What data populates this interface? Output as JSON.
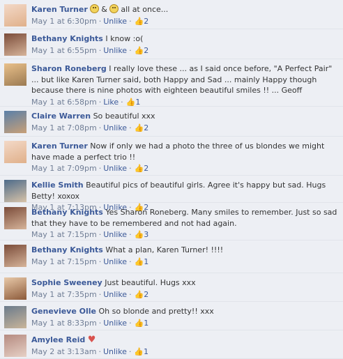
{
  "comments": [
    {
      "name": "Karen Turner",
      "text": "",
      "time": "May 1 at 6:30pm",
      "action": "Unlike",
      "likes": "2",
      "avatar": "karen-turner-avatar",
      "colors": [
        "#f3d9c8",
        "#e0b08a"
      ],
      "rich": {
        "mid": "&",
        "tail": "all at once..."
      }
    },
    {
      "name": "Bethany Knights",
      "text": "I know :o(",
      "time": "May 1 at 6:55pm",
      "action": "Unlike",
      "likes": "2",
      "avatar": "bethany-knights-avatar",
      "colors": [
        "#7b4c3a",
        "#d6b49a"
      ]
    },
    {
      "name": "Sharon Roneberg",
      "text": "I really love these ... as I said once before, \"A Perfect Pair\" ... but like Karen Turner said, both Happy and Sad ... mainly Happy though because there is nine photos with eighteen beautiful smiles !! ... Geoff",
      "time": "May 1 at 6:58pm",
      "action": "Like",
      "likes": "1",
      "avatar": "sharon-roneberg-avatar",
      "colors": [
        "#e9c08a",
        "#9b7a52"
      ]
    },
    {
      "name": "Claire Warren",
      "text": "So beautiful xxx",
      "time": "May 1 at 7:08pm",
      "action": "Unlike",
      "likes": "2",
      "avatar": "claire-warren-avatar",
      "colors": [
        "#5a7fa8",
        "#c8a078"
      ]
    },
    {
      "name": "Karen Turner",
      "text": "Now if only we had a photo the three of us blondes we might have made a perfect trio !!",
      "time": "May 1 at 7:09pm",
      "action": "Unlike",
      "likes": "2",
      "avatar": "karen-turner-avatar",
      "colors": [
        "#f3d9c8",
        "#e0b08a"
      ]
    },
    {
      "name": "Kellie Smith",
      "text": "Beautiful pics of beautiful girls. Agree it's happy but sad. Hugs Betty! xoxox",
      "time": "May 1 at 7:13pm",
      "action": "Unlike",
      "likes": "2",
      "avatar": "kellie-smith-avatar",
      "colors": [
        "#4d6b8a",
        "#d8c3a8"
      ]
    },
    {
      "name": "Bethany Knights",
      "text": "Yes Sharon Roneberg. Many smiles to remember. Just so sad that they have to be remembered and not had again.",
      "time": "May 1 at 7:15pm",
      "action": "Unlike",
      "likes": "3",
      "avatar": "bethany-knights-avatar",
      "colors": [
        "#7b4c3a",
        "#d6b49a"
      ]
    },
    {
      "name": "Bethany Knights",
      "text": "What a plan, Karen Turner! !!!!",
      "time": "May 1 at 7:15pm",
      "action": "Unlike",
      "likes": "1",
      "avatar": "bethany-knights-avatar",
      "colors": [
        "#7b4c3a",
        "#d6b49a"
      ]
    },
    {
      "name": "Sophie Sweeney",
      "text": "Just beautiful. Hugs xxx",
      "time": "May 1 at 7:35pm",
      "action": "Unlike",
      "likes": "2",
      "avatar": "sophie-sweeney-avatar",
      "colors": [
        "#e8c9a9",
        "#8c5a3a"
      ]
    },
    {
      "name": "Genevieve Olle",
      "text": "Oh so blonde and pretty!! xxx",
      "time": "May 1 at 8:33pm",
      "action": "Unlike",
      "likes": "1",
      "avatar": "genevieve-olle-avatar",
      "colors": [
        "#6b7b8c",
        "#c9b59a"
      ]
    },
    {
      "name": "Amylee Reid",
      "text": "",
      "time": "May 2 at 3:13am",
      "action": "Unlike",
      "likes": "1",
      "avatar": "amylee-reid-avatar",
      "colors": [
        "#b58a80",
        "#e6d1c6"
      ],
      "heart": true
    }
  ]
}
